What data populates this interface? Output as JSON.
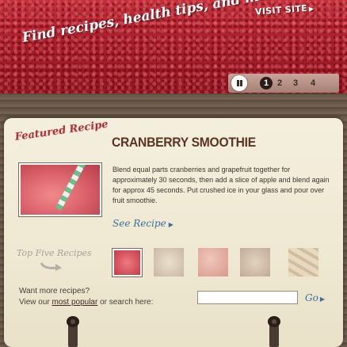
{
  "banner": {
    "tagline": "Find recipes, health tips, and more",
    "visit_site": "VISIT SITE",
    "visit_arrow_icon": "triangle-right"
  },
  "pager": {
    "pause_icon": "pause",
    "pages": [
      "1",
      "2",
      "3",
      "4"
    ],
    "active_page": "1"
  },
  "featured": {
    "label": "Featured Recipe",
    "title": "CRANBERRY SMOOTHIE",
    "description": "Blend equal parts cranberries and grapefruit together for approximately 30 seconds, then add a slice of apple and blend again for approx 45 seconds. Put crushed ice in your glass and pour over fruit smoothie.",
    "see_recipe": "See Recipe",
    "image": "cranberry-smoothie-photo"
  },
  "top_five": {
    "label": "Top Five Recipes",
    "thumbnails": [
      {
        "name": "smoothie",
        "color": "#d94a55",
        "active": true
      },
      {
        "name": "cranberry-sauce",
        "color": "#b58c7a",
        "active": false
      },
      {
        "name": "cranberry-tea",
        "color": "#c94040",
        "active": false
      },
      {
        "name": "cranberry-dish",
        "color": "#9a7060",
        "active": false
      },
      {
        "name": "cranberry-bars",
        "color": "#c8aa88",
        "active": false
      }
    ]
  },
  "more": {
    "line1": "Want more recipes?",
    "line2_prefix": "View our ",
    "most_popular": "most popular",
    "line2_suffix": " or search here:",
    "search_value": "",
    "go": "Go"
  },
  "colors": {
    "cranberry": "#a81e2c",
    "card": "#f1ebd6",
    "title": "#5a3322",
    "link": "#3c6f9a"
  }
}
